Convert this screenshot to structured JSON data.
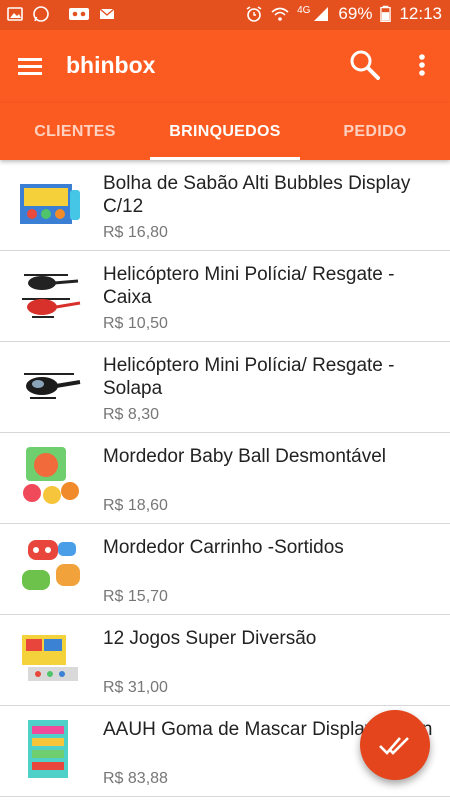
{
  "statusbar": {
    "network_badge": "4G",
    "battery": "69%",
    "time": "12:13"
  },
  "appbar": {
    "title": "bhinbox",
    "menu_icon": "hamburger-menu-icon",
    "search_icon": "search-icon",
    "more_icon": "more-vert-icon"
  },
  "tabs": [
    {
      "label": "CLIENTES",
      "active": false
    },
    {
      "label": "BRINQUEDOS",
      "active": true
    },
    {
      "label": "PEDIDO",
      "active": false
    }
  ],
  "products": [
    {
      "name": "Bolha de Sabão Alti Bubbles Display C/12",
      "price": "R$ 16,80"
    },
    {
      "name": "Helicóptero Mini Polícia/ Resgate - Caixa",
      "price": "R$ 10,50"
    },
    {
      "name": "Helicóptero Mini Polícia/ Resgate - Solapa",
      "price": "R$ 8,30"
    },
    {
      "name": "Mordedor Baby Ball Desmontável",
      "price": "R$ 18,60"
    },
    {
      "name": "Mordedor Carrinho -Sortidos",
      "price": "R$ 15,70"
    },
    {
      "name": "12 Jogos Super Diversão",
      "price": "R$ 31,00"
    },
    {
      "name": "AAUH Goma de Mascar Display 100un",
      "price": "R$ 83,88"
    }
  ],
  "fab": {
    "icon": "double-check-icon"
  },
  "colors": {
    "primary": "#fb5a20",
    "status_bar": "#e4511f",
    "fab": "#e4451c"
  }
}
